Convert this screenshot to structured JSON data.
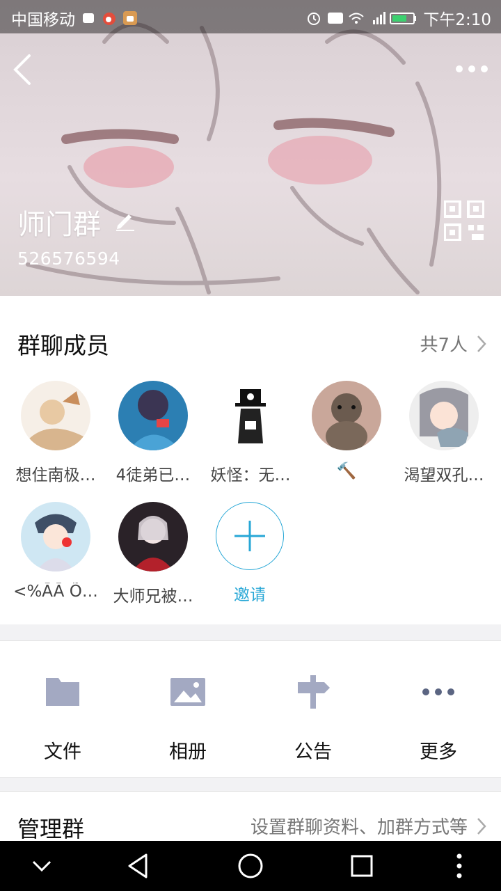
{
  "status_bar": {
    "carrier": "中国移动",
    "time": "下午2:10",
    "icons": [
      "alarm-icon",
      "hd-icon",
      "wifi-icon",
      "4g-signal-icon",
      "battery-icon"
    ]
  },
  "header": {
    "back_icon": "back-arrow-icon",
    "more_icon": "more-dots-icon",
    "group_name": "师门群",
    "edit_icon": "pencil-icon",
    "group_id": "526576594",
    "qr_icon": "qr-code-icon"
  },
  "members": {
    "title": "群聊成员",
    "count": "共7人",
    "items": [
      {
        "name": "想住南极…"
      },
      {
        "name": "4徒弟已…"
      },
      {
        "name": "妖怪：无…"
      },
      {
        "name": "🔨"
      },
      {
        "name": "渴望双孔…"
      },
      {
        "name": "<%ĀĀ Õ…"
      },
      {
        "name": "大师兄被…"
      }
    ],
    "invite_label": "邀请"
  },
  "actions": [
    {
      "label": "文件",
      "icon": "folder-icon"
    },
    {
      "label": "相册",
      "icon": "image-icon"
    },
    {
      "label": "公告",
      "icon": "signpost-icon"
    },
    {
      "label": "更多",
      "icon": "more-icon"
    }
  ],
  "manage": {
    "title": "管理群",
    "desc": "设置群聊资料、加群方式等"
  },
  "colors": {
    "accent": "#27a7d6",
    "action_icon": "#a3a9c2"
  }
}
